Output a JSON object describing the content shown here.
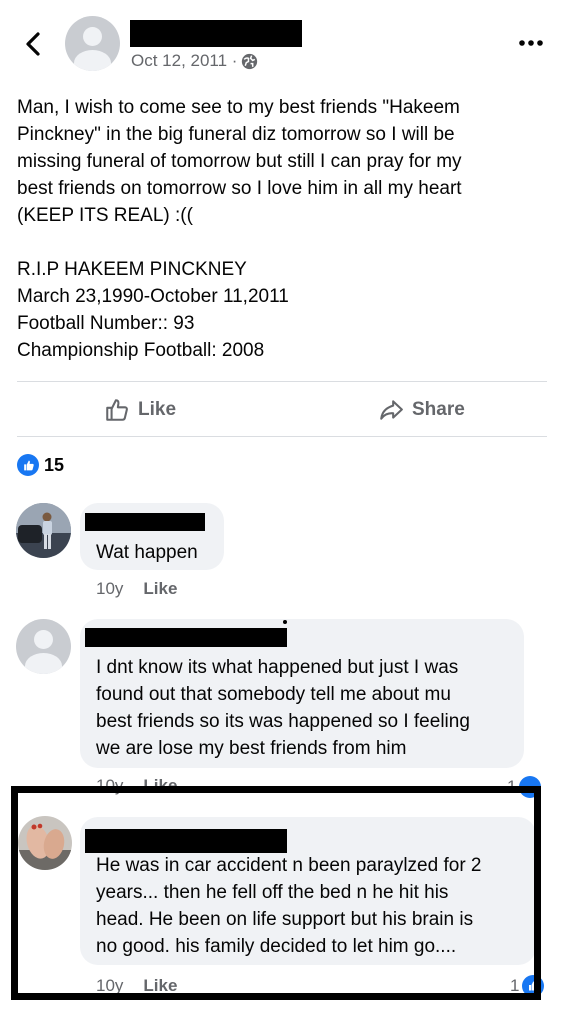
{
  "header": {
    "back_icon": "chevron-left-icon",
    "date": "Oct 12, 2011 ·",
    "privacy_icon": "globe-icon",
    "more_icon": "ellipsis-icon"
  },
  "post": {
    "lines": [
      "Man, I wish to come see to my best friends \"Hakeem",
      "Pinckney\" in the big funeral diz tomorrow so I will be",
      "missing funeral of tomorrow but still I can pray for my",
      "best friends on tomorrow so I love him in all my heart",
      "(KEEP ITS REAL) :((",
      "R.I.P HAKEEM PINCKNEY",
      "March 23,1990-October 11,2011",
      "Football Number:: 93",
      "Championship Football: 2008"
    ]
  },
  "actions": {
    "like_label": "Like",
    "share_label": "Share"
  },
  "reactions": {
    "count": "15"
  },
  "comments": [
    {
      "lines": [
        "Wat happen"
      ],
      "time": "10y",
      "like_label": "Like"
    },
    {
      "lines": [
        "I dnt know its what happened but just I was",
        "found out that somebody tell me about mu",
        "best friends so its was happened so I feeling",
        "we are lose my best friends from him"
      ],
      "time": "10y",
      "like_label": "Like",
      "reactions": "1"
    },
    {
      "lines": [
        "He was in car accident n been paraylzed for 2",
        "years... then he fell off the bed n he hit his",
        "head. He been on life support but his brain is",
        "no good. his family decided to let him go...."
      ],
      "time": "10y",
      "like_label": "Like",
      "reactions": "1"
    }
  ]
}
